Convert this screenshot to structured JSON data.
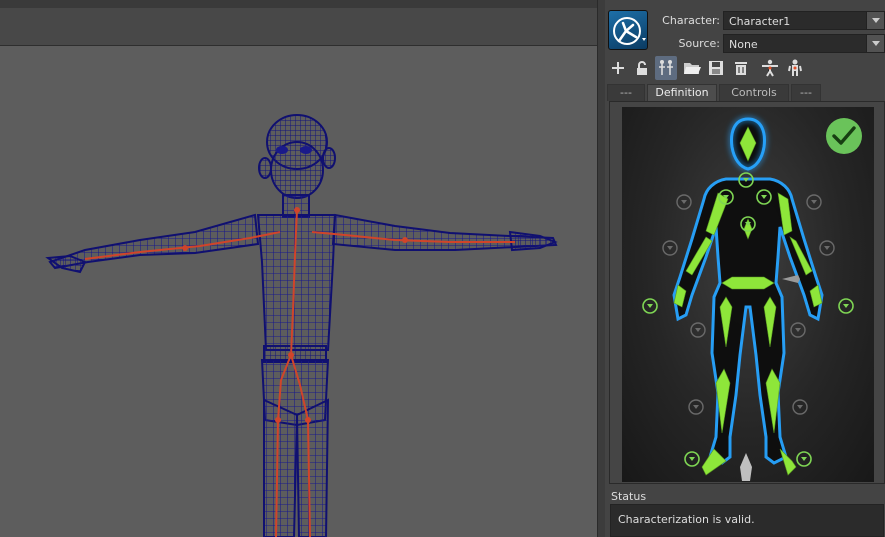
{
  "hik": {
    "character_label": "Character:",
    "character_value": "Character1",
    "source_label": "Source:",
    "source_value": "None",
    "tabs": [
      {
        "label": "---",
        "active": false
      },
      {
        "label": "Definition",
        "active": true
      },
      {
        "label": "Controls",
        "active": false
      },
      {
        "label": "---",
        "active": false
      }
    ],
    "toolbar_icons": [
      "add-icon",
      "unlock-icon",
      "skeleton-definition-icon",
      "open-folder-icon",
      "save-icon",
      "delete-icon",
      "t-pose-skeleton-icon",
      "character-icon"
    ],
    "status_label": "Status",
    "status_text": "Characterization is valid.",
    "valid_icon": "checkmark-icon"
  },
  "colors": {
    "bone_green": "#8ee63a",
    "mesh_wire": "#1a1a8a",
    "joint_red": "#d0442a",
    "accent_blue": "#5e6c80"
  }
}
